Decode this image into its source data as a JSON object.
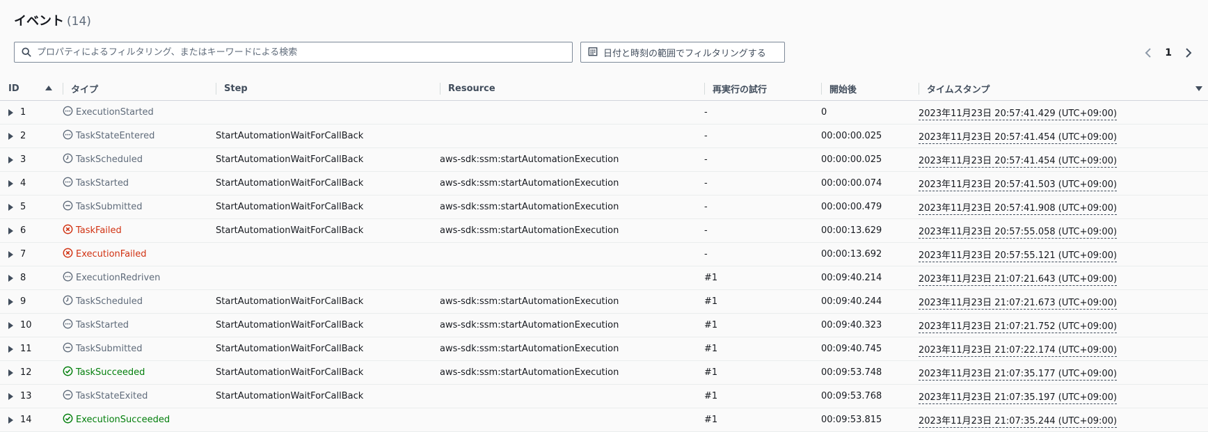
{
  "header": {
    "title": "イベント",
    "count": "(14)"
  },
  "search": {
    "placeholder": "プロパティによるフィルタリング、またはキーワードによる検索",
    "value": ""
  },
  "date_filter": {
    "label": "日付と時刻の範囲でフィルタリングする"
  },
  "pagination": {
    "current_page": "1"
  },
  "columns": [
    "ID",
    "タイプ",
    "Step",
    "Resource",
    "再実行の試行",
    "開始後",
    "タイムスタンプ"
  ],
  "status_colors": {
    "gray": "#5f6b7a",
    "red": "#d13212",
    "green": "#037f0c"
  },
  "rows": [
    {
      "id": "1",
      "icon": "ellipsis-circle-icon",
      "status": "gray",
      "type": "ExecutionStarted",
      "step": "",
      "resource": "",
      "redrive": "-",
      "elapsed": "0",
      "timestamp": "2023年11月23日 20:57:41.429 (UTC+09:00)"
    },
    {
      "id": "2",
      "icon": "ellipsis-circle-icon",
      "status": "gray",
      "type": "TaskStateEntered",
      "step": "StartAutomationWaitForCallBack",
      "resource": "",
      "redrive": "-",
      "elapsed": "00:00:00.025",
      "timestamp": "2023年11月23日 20:57:41.454 (UTC+09:00)"
    },
    {
      "id": "3",
      "icon": "clock-icon",
      "status": "gray",
      "type": "TaskScheduled",
      "step": "StartAutomationWaitForCallBack",
      "resource": "aws-sdk:ssm:startAutomationExecution",
      "redrive": "-",
      "elapsed": "00:00:00.025",
      "timestamp": "2023年11月23日 20:57:41.454 (UTC+09:00)"
    },
    {
      "id": "4",
      "icon": "ellipsis-circle-icon",
      "status": "gray",
      "type": "TaskStarted",
      "step": "StartAutomationWaitForCallBack",
      "resource": "aws-sdk:ssm:startAutomationExecution",
      "redrive": "-",
      "elapsed": "00:00:00.074",
      "timestamp": "2023年11月23日 20:57:41.503 (UTC+09:00)"
    },
    {
      "id": "5",
      "icon": "minus-circle-icon",
      "status": "gray",
      "type": "TaskSubmitted",
      "step": "StartAutomationWaitForCallBack",
      "resource": "aws-sdk:ssm:startAutomationExecution",
      "redrive": "-",
      "elapsed": "00:00:00.479",
      "timestamp": "2023年11月23日 20:57:41.908 (UTC+09:00)"
    },
    {
      "id": "6",
      "icon": "x-circle-icon",
      "status": "red",
      "type": "TaskFailed",
      "step": "StartAutomationWaitForCallBack",
      "resource": "aws-sdk:ssm:startAutomationExecution",
      "redrive": "-",
      "elapsed": "00:00:13.629",
      "timestamp": "2023年11月23日 20:57:55.058 (UTC+09:00)"
    },
    {
      "id": "7",
      "icon": "x-circle-icon",
      "status": "red",
      "type": "ExecutionFailed",
      "step": "",
      "resource": "",
      "redrive": "-",
      "elapsed": "00:00:13.692",
      "timestamp": "2023年11月23日 20:57:55.121 (UTC+09:00)"
    },
    {
      "id": "8",
      "icon": "ellipsis-circle-icon",
      "status": "gray",
      "type": "ExecutionRedriven",
      "step": "",
      "resource": "",
      "redrive": "#1",
      "elapsed": "00:09:40.214",
      "timestamp": "2023年11月23日 21:07:21.643 (UTC+09:00)"
    },
    {
      "id": "9",
      "icon": "clock-icon",
      "status": "gray",
      "type": "TaskScheduled",
      "step": "StartAutomationWaitForCallBack",
      "resource": "aws-sdk:ssm:startAutomationExecution",
      "redrive": "#1",
      "elapsed": "00:09:40.244",
      "timestamp": "2023年11月23日 21:07:21.673 (UTC+09:00)"
    },
    {
      "id": "10",
      "icon": "ellipsis-circle-icon",
      "status": "gray",
      "type": "TaskStarted",
      "step": "StartAutomationWaitForCallBack",
      "resource": "aws-sdk:ssm:startAutomationExecution",
      "redrive": "#1",
      "elapsed": "00:09:40.323",
      "timestamp": "2023年11月23日 21:07:21.752 (UTC+09:00)"
    },
    {
      "id": "11",
      "icon": "minus-circle-icon",
      "status": "gray",
      "type": "TaskSubmitted",
      "step": "StartAutomationWaitForCallBack",
      "resource": "aws-sdk:ssm:startAutomationExecution",
      "redrive": "#1",
      "elapsed": "00:09:40.745",
      "timestamp": "2023年11月23日 21:07:22.174 (UTC+09:00)"
    },
    {
      "id": "12",
      "icon": "check-circle-icon",
      "status": "green",
      "type": "TaskSucceeded",
      "step": "StartAutomationWaitForCallBack",
      "resource": "aws-sdk:ssm:startAutomationExecution",
      "redrive": "#1",
      "elapsed": "00:09:53.748",
      "timestamp": "2023年11月23日 21:07:35.177 (UTC+09:00)"
    },
    {
      "id": "13",
      "icon": "minus-circle-icon",
      "status": "gray",
      "type": "TaskStateExited",
      "step": "StartAutomationWaitForCallBack",
      "resource": "",
      "redrive": "#1",
      "elapsed": "00:09:53.768",
      "timestamp": "2023年11月23日 21:07:35.197 (UTC+09:00)"
    },
    {
      "id": "14",
      "icon": "check-circle-icon",
      "status": "green",
      "type": "ExecutionSucceeded",
      "step": "",
      "resource": "",
      "redrive": "#1",
      "elapsed": "00:09:53.815",
      "timestamp": "2023年11月23日 21:07:35.244 (UTC+09:00)"
    }
  ]
}
